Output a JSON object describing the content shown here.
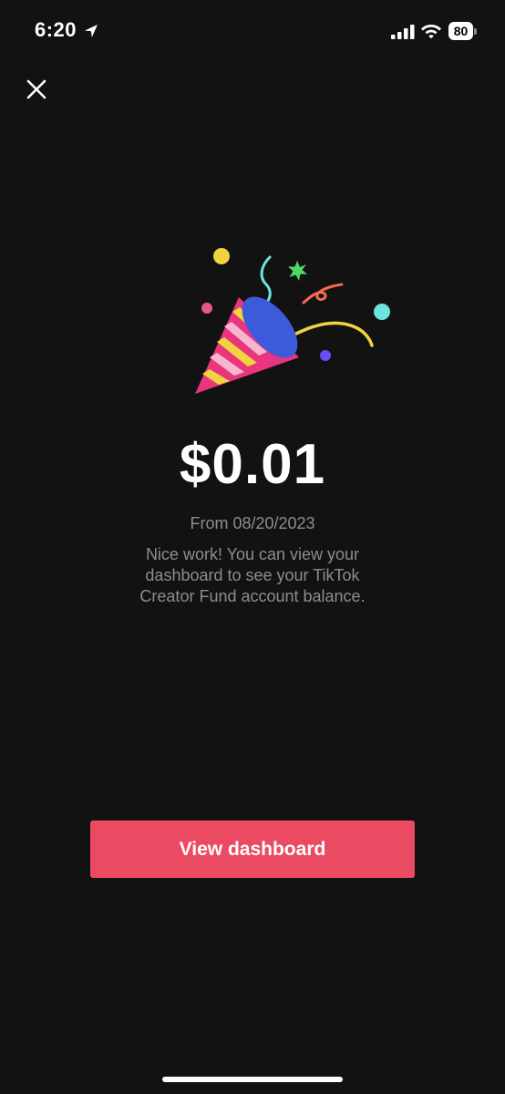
{
  "status_bar": {
    "time": "6:20",
    "battery_level": "80",
    "icons": [
      "location-arrow-icon",
      "cellular-signal-icon",
      "wifi-icon",
      "battery-icon"
    ]
  },
  "header": {
    "close_icon": "close-icon"
  },
  "illustration": {
    "icon": "party-popper-icon",
    "colors": {
      "cone_pink": "#e8357e",
      "cone_stripe": "#f2d33f",
      "cone_light_stripe": "#f6b6cf",
      "cone_top": "#3b5bdb",
      "confetti_yellow": "#f2d33f",
      "confetti_cyan": "#6fe3e0",
      "confetti_green": "#4cd964",
      "confetti_orange": "#f26b4f",
      "confetti_purple": "#6a4cf2",
      "confetti_pink": "#e8578a"
    }
  },
  "content": {
    "amount": "$0.01",
    "from_date": "From 08/20/2023",
    "description": "Nice work! You can view your dashboard to see your TikTok Creator Fund account balance."
  },
  "actions": {
    "view_dashboard_label": "View dashboard",
    "button_color": "#ea4b63"
  }
}
